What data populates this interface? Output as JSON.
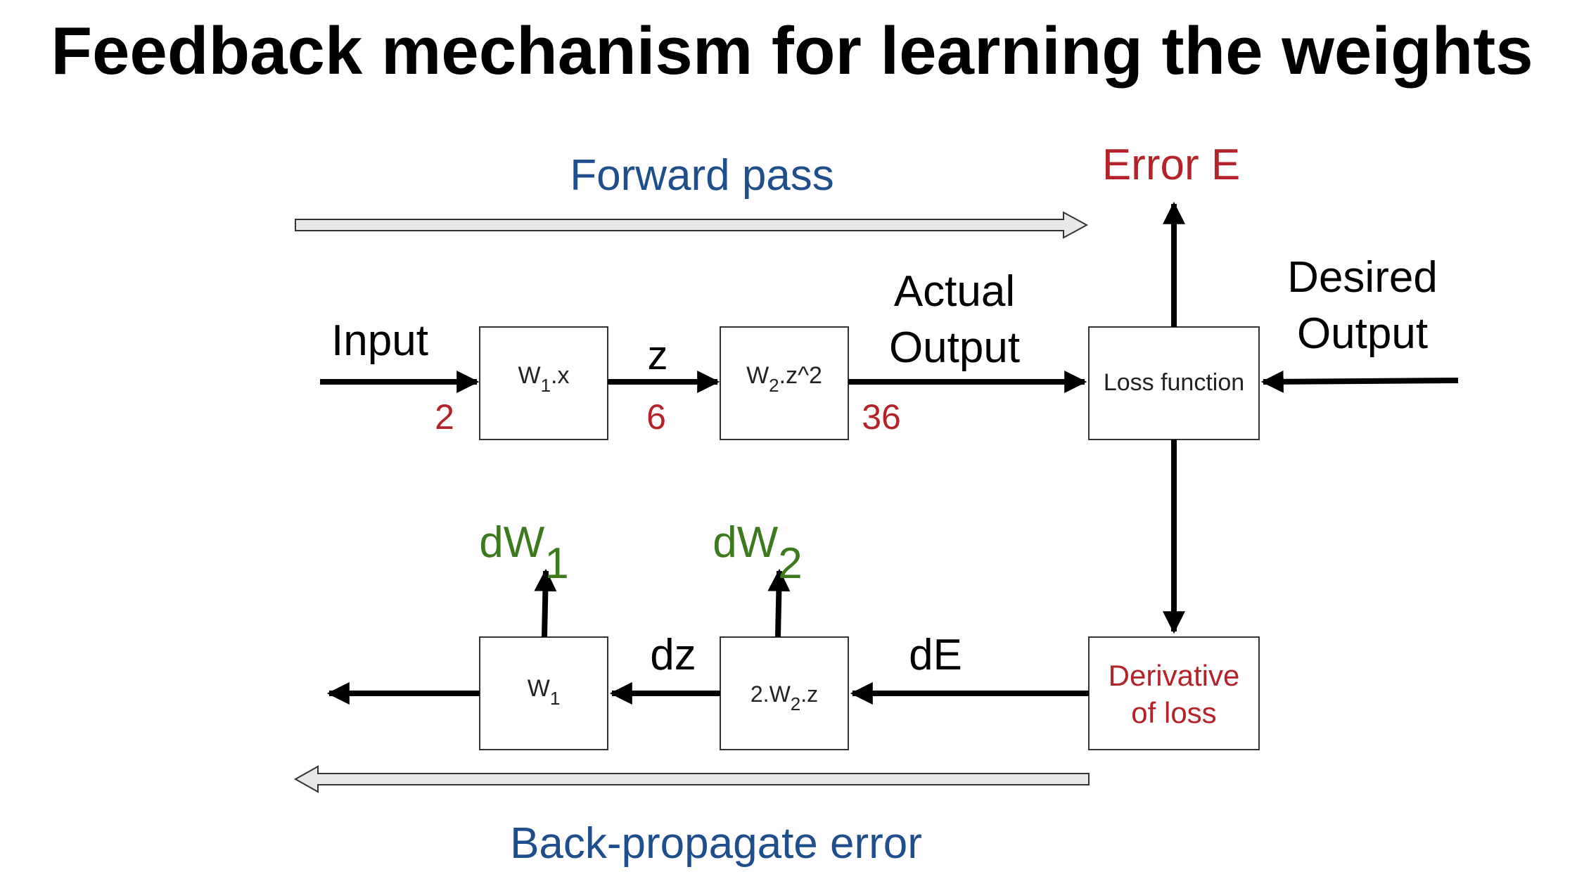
{
  "title": "Feedback mechanism for learning the weights",
  "colors": {
    "blue": "#1f4e8c",
    "red": "#b5232a",
    "green": "#3d7a1e",
    "black": "#000000",
    "hollow_arrow_fill": "#e8e8e8"
  },
  "forward": {
    "label": "Forward pass",
    "input_label": "Input",
    "input_value": "2",
    "box1": {
      "main": "W",
      "sub": "1",
      "suffix": ".x"
    },
    "z_label": "z",
    "z_value": "6",
    "box2": {
      "main": "W",
      "sub": "2",
      "suffix": ".z^2"
    },
    "actual_output_line1": "Actual",
    "actual_output_line2": "Output",
    "output_value": "36",
    "loss_box": "Loss function",
    "desired_output_line1": "Desired",
    "desired_output_line2": "Output",
    "error_label": "Error E"
  },
  "backward": {
    "label": "Back-propagate error",
    "derivative_line1": "Derivative",
    "derivative_line2": "of loss",
    "dE_label": "dE",
    "box2": {
      "prefix": "2.W",
      "sub": "2",
      "suffix": ".z"
    },
    "dz_label": "dz",
    "box1": {
      "main": "W",
      "sub": "1"
    },
    "dW1": {
      "main": "dW",
      "sub": "1"
    },
    "dW2": {
      "main": "dW",
      "sub": "2"
    }
  }
}
